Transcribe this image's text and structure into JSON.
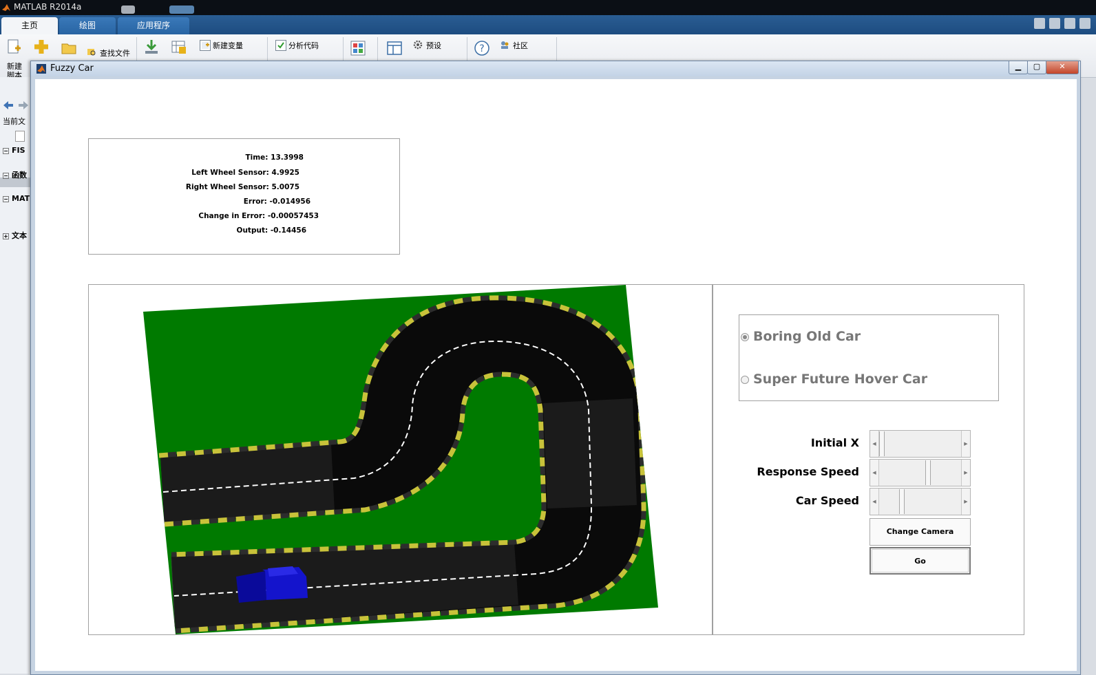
{
  "main_window": {
    "title": "MATLAB R2014a",
    "tabs": [
      {
        "label": "主页",
        "active": true
      },
      {
        "label": "绘图",
        "active": false
      },
      {
        "label": "应用程序",
        "active": false
      }
    ],
    "ribbon": {
      "new_script_label": "新建\n脚本",
      "find_files_label": "查找文件",
      "new_variable_label": "新建变量",
      "analyze_code_label": "分析代码",
      "preferences_label": "预设",
      "community_label": "社区"
    }
  },
  "left_panel": {
    "current_folder_label": "当前文",
    "tree": [
      {
        "label": "FIS",
        "expanded": true
      },
      {
        "label": "函数",
        "expanded": true
      },
      {
        "label": "MAT",
        "expanded": true
      },
      {
        "label": "文本",
        "expanded": false
      }
    ]
  },
  "figure_window": {
    "title": "Fuzzy Car",
    "info": {
      "time": "Time: 13.3998",
      "left_sensor": "Left Wheel Sensor: 4.9925",
      "right_sensor": "Right Wheel Sensor: 5.0075",
      "error": "Error: -0.014956",
      "change_in_error": "Change in Error: -0.00057453",
      "output": "Output: -0.14456"
    },
    "car_options": [
      {
        "label": "Boring Old Car",
        "selected": true
      },
      {
        "label": "Super Future Hover Car",
        "selected": false
      }
    ],
    "sliders": [
      {
        "label": "Initial X",
        "value": 0.0
      },
      {
        "label": "Response Speed",
        "value": 0.6
      },
      {
        "label": "Car Speed",
        "value": 0.28
      }
    ],
    "buttons": {
      "change_camera": "Change Camera",
      "go": "Go"
    }
  },
  "colors": {
    "grass": "#007a00",
    "track": "#0a0a0a",
    "straight_track": "#1a1a1a",
    "curb_yellow": "#c8c23a",
    "curb_dark": "#3a3a3a",
    "car": "#1010cc",
    "lane_line": "#ffffff"
  }
}
